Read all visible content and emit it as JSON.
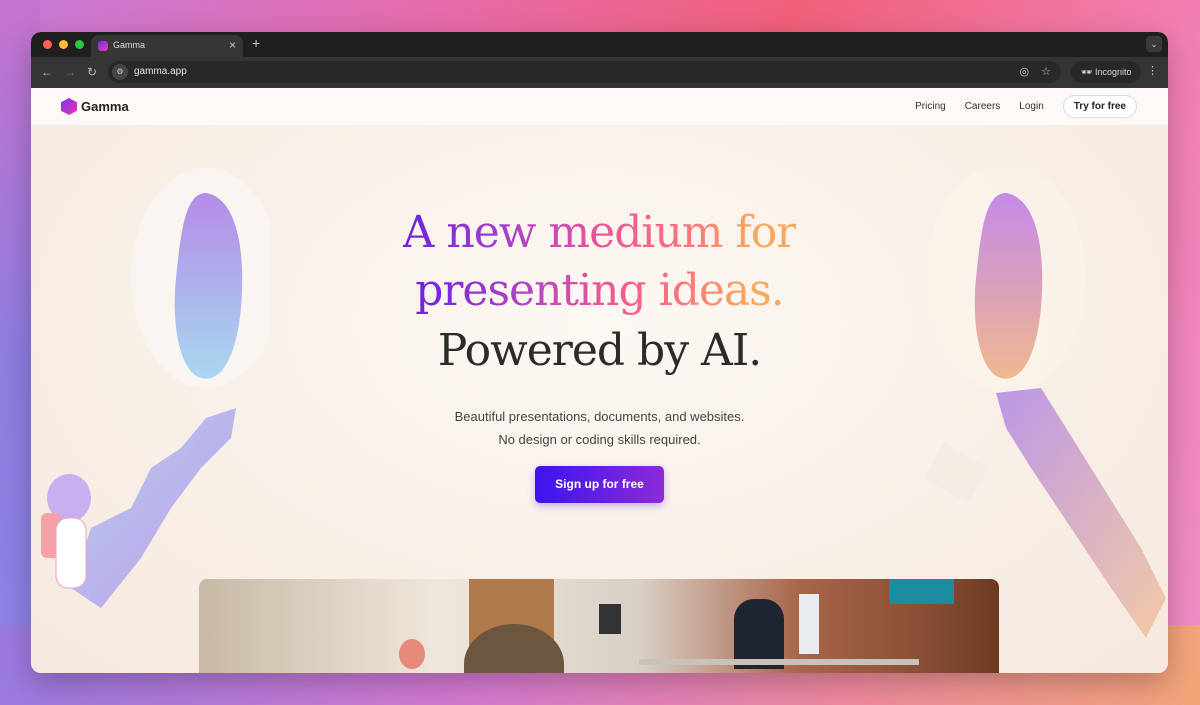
{
  "browser": {
    "tab_title": "Gamma",
    "new_tab_label": "+",
    "url": "gamma.app",
    "incognito_label": "Incognito",
    "colors": {
      "close": "#ff5f57",
      "minimize": "#febc2e",
      "zoom": "#28c840"
    }
  },
  "site": {
    "brand": "Gamma",
    "nav": [
      {
        "label": "Pricing"
      },
      {
        "label": "Careers"
      },
      {
        "label": "Login"
      }
    ],
    "try_button": "Try for free"
  },
  "hero": {
    "headline_line1": "A new medium for",
    "headline_line2": "presenting ideas.",
    "headline_line3": "Powered by AI.",
    "sub_line1": "Beautiful presentations, documents, and websites.",
    "sub_line2": "No design or coding skills required.",
    "cta": "Sign up for free",
    "colors": {
      "gradient_start": "#6b22e0",
      "gradient_mid": "#e9549a",
      "gradient_end": "#f7a85c",
      "cta_start": "#3b14ee",
      "cta_end": "#8d2ad8"
    }
  },
  "icons": {
    "back": "←",
    "forward": "→",
    "reload": "↻",
    "site_settings": "⚙",
    "eye_off": "◎",
    "star": "☆",
    "kebab": "⋮",
    "chevron": "⌄",
    "close": "×"
  }
}
